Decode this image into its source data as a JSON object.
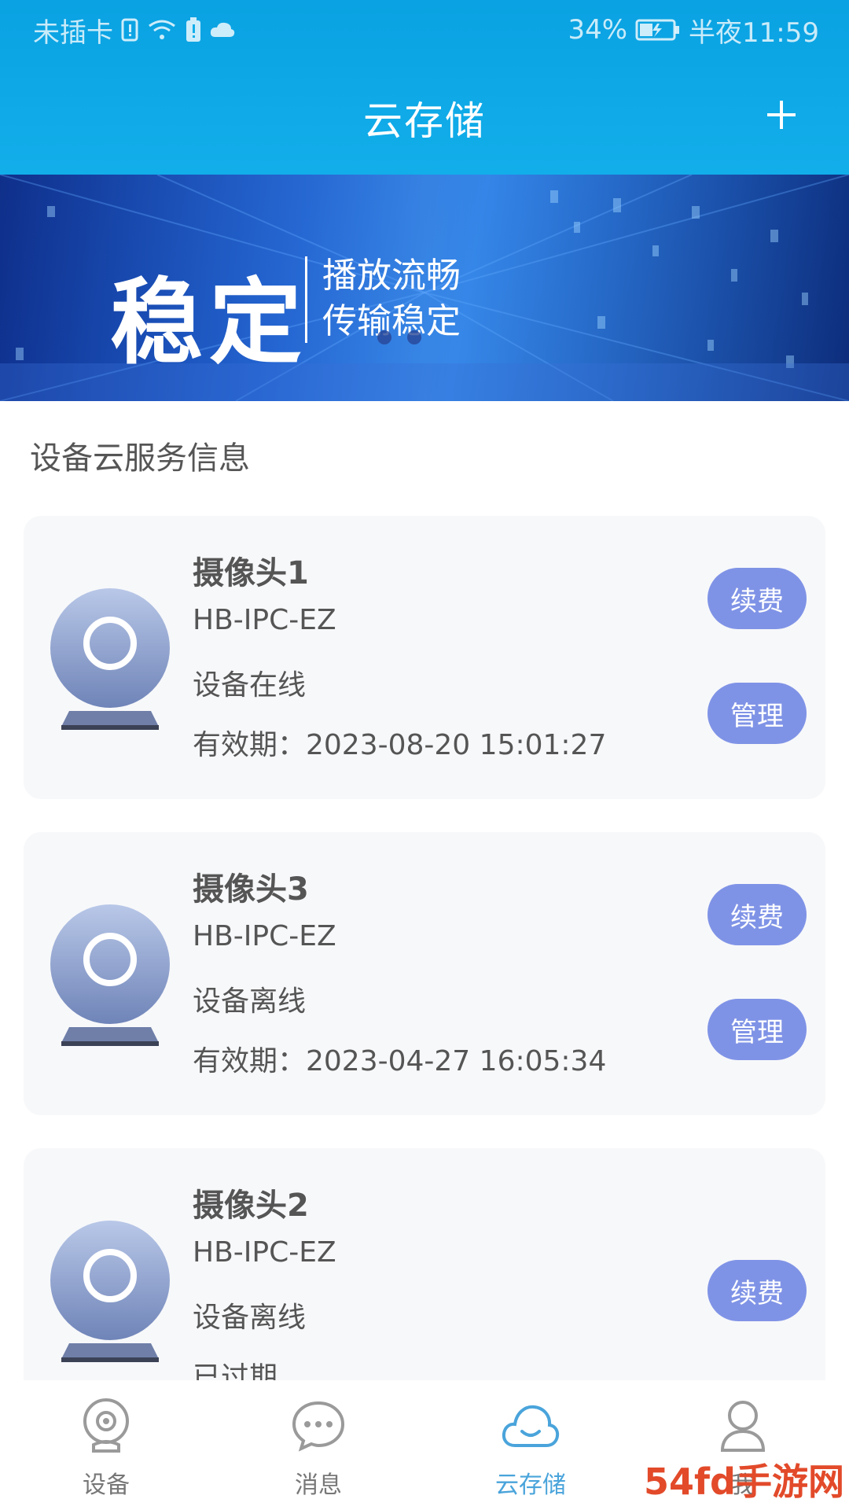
{
  "status_bar": {
    "carrier": "未插卡",
    "battery_percent": "34%",
    "time": "半夜11:59"
  },
  "header": {
    "title": "云存储",
    "add_icon": "plus-icon"
  },
  "banner": {
    "main_text": "稳定",
    "sub_line1": "播放流畅",
    "sub_line2": "传输稳定"
  },
  "section": {
    "title": "设备云服务信息"
  },
  "devices": [
    {
      "name": "摄像头1",
      "model": "HB-IPC-EZ",
      "status": "设备在线",
      "expiry": "有效期：2023-08-20 15:01:27",
      "renew_label": "续费",
      "manage_label": "管理"
    },
    {
      "name": "摄像头3",
      "model": "HB-IPC-EZ",
      "status": "设备离线",
      "expiry": "有效期：2023-04-27 16:05:34",
      "renew_label": "续费",
      "manage_label": "管理"
    },
    {
      "name": "摄像头2",
      "model": "HB-IPC-EZ",
      "status": "设备离线",
      "expiry": "已过期",
      "renew_label": "续费"
    }
  ],
  "tabbar": {
    "items": [
      {
        "label": "设备",
        "icon": "camera-icon",
        "active": false
      },
      {
        "label": "消息",
        "icon": "chat-icon",
        "active": false
      },
      {
        "label": "云存储",
        "icon": "cloud-icon",
        "active": true
      },
      {
        "label": "我",
        "icon": "user-icon",
        "active": false
      }
    ]
  },
  "watermark": "54fd手游网",
  "colors": {
    "header": "#0aa2e2",
    "pill": "#7f93e6",
    "tab_active": "#4aa4db"
  }
}
